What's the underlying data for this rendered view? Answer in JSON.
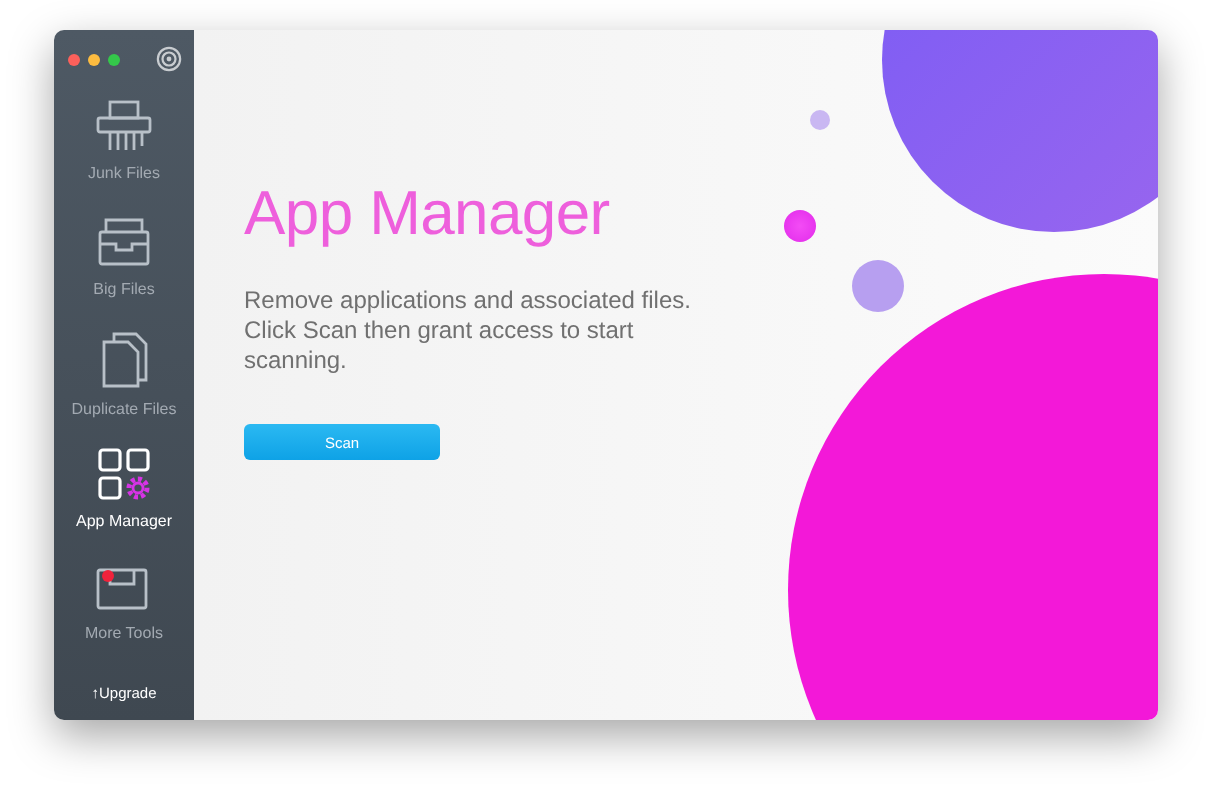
{
  "sidebar": {
    "items": [
      {
        "label": "Junk Files",
        "kind": "shredder",
        "selected": false,
        "notification": false
      },
      {
        "label": "Big Files",
        "kind": "tray",
        "selected": false,
        "notification": false
      },
      {
        "label": "Duplicate Files",
        "kind": "documents",
        "selected": false,
        "notification": false
      },
      {
        "label": "App Manager",
        "kind": "apps",
        "selected": true,
        "notification": false
      },
      {
        "label": "More Tools",
        "kind": "toolbox",
        "selected": false,
        "notification": true
      }
    ],
    "upgrade": {
      "icon": "↑",
      "label": "Upgrade"
    }
  },
  "main": {
    "title": "App Manager",
    "description": "Remove applications and associated files. Click Scan then grant access to start scanning.",
    "button": "Scan"
  }
}
